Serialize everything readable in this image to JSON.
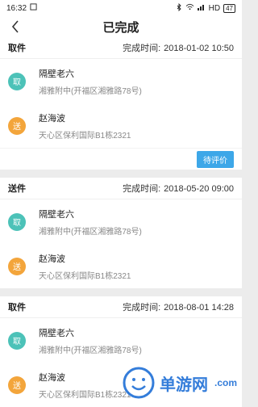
{
  "status_bar": {
    "time": "16:32",
    "network": "HD",
    "battery": "47"
  },
  "header": {
    "title": "已完成"
  },
  "orders": [
    {
      "type": "取件",
      "time_label": "完成时间:",
      "time_value": "2018-01-02 10:50",
      "pickup": {
        "badge": "取",
        "name": "隔壁老六",
        "address": "湘雅附中(开福区湘雅路78号)"
      },
      "delivery": {
        "badge": "送",
        "name": "赵海波",
        "address": "天心区保利国际B1栋2321"
      },
      "action_label": "待评价"
    },
    {
      "type": "送件",
      "time_label": "完成时间:",
      "time_value": "2018-05-20 09:00",
      "pickup": {
        "badge": "取",
        "name": "隔壁老六",
        "address": "湘雅附中(开福区湘雅路78号)"
      },
      "delivery": {
        "badge": "送",
        "name": "赵海波",
        "address": "天心区保利国际B1栋2321"
      }
    },
    {
      "type": "取件",
      "time_label": "完成时间:",
      "time_value": "2018-08-01 14:28",
      "pickup": {
        "badge": "取",
        "name": "隔壁老六",
        "address": "湘雅附中(开福区湘雅路78号)"
      },
      "delivery": {
        "badge": "送",
        "name": "赵海波",
        "address": "天心区保利国际B1栋2321"
      }
    }
  ],
  "watermark": {
    "brand": "单游网",
    "domain": ".com"
  }
}
